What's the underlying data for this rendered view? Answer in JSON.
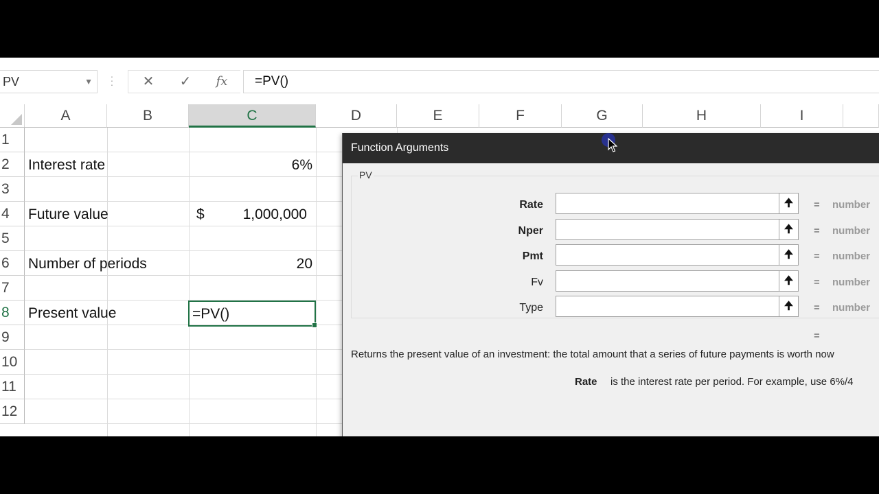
{
  "formula_bar": {
    "name_box": "PV",
    "cancel_icon": "close-icon",
    "enter_icon": "check-icon",
    "fx_label": "fx",
    "formula": "=PV()"
  },
  "columns": [
    "A",
    "B",
    "C",
    "D",
    "E",
    "F",
    "G",
    "H",
    "I"
  ],
  "rows": [
    "1",
    "2",
    "3",
    "4",
    "5",
    "6",
    "7",
    "8",
    "9",
    "10",
    "11",
    "12"
  ],
  "cells": {
    "a2": "Interest rate",
    "c2": "6%",
    "a4": "Future value",
    "c4_symbol": "$",
    "c4": "1,000,000",
    "a6": "Number of periods",
    "c6": "20",
    "a8": "Present value",
    "c8": "=PV()"
  },
  "dialog": {
    "title": "Function Arguments",
    "function_name": "PV",
    "args": [
      {
        "label": "Rate",
        "value": "",
        "result_eq": "=",
        "result": "number"
      },
      {
        "label": "Nper",
        "value": "",
        "result_eq": "=",
        "result": "number"
      },
      {
        "label": "Pmt",
        "value": "",
        "result_eq": "=",
        "result": "number"
      },
      {
        "label": "Fv",
        "value": "",
        "result_eq": "=",
        "result": "number"
      },
      {
        "label": "Type",
        "value": "",
        "result_eq": "=",
        "result": "number"
      }
    ],
    "result_eq": "=",
    "description": "Returns the present value of an investment: the total amount that a series of future payments is worth now",
    "arg_help_name": "Rate",
    "arg_help_text": "is the interest rate per period. For example, use 6%/4"
  },
  "colors": {
    "excel_green": "#217346",
    "dialog_title_bg": "#2b2b2b"
  }
}
